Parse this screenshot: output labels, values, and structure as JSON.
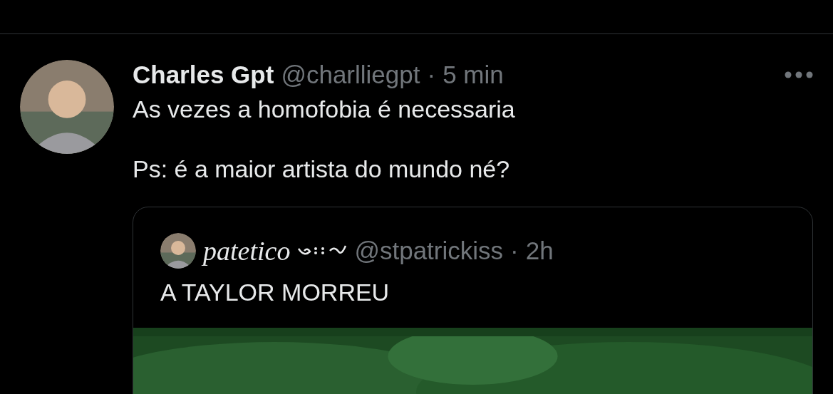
{
  "tweet": {
    "name": "Charles Gpt",
    "handle": "@charlliegpt",
    "separator": "·",
    "time": "5 min",
    "lines": [
      "As vezes a homofobia é necessaria",
      "Ps: é a maior artista do mundo né?"
    ],
    "quote": {
      "name": "patetico",
      "handle": "@stpatrickiss",
      "separator": "·",
      "time": "2h",
      "text": "A TAYLOR MORREU"
    }
  }
}
